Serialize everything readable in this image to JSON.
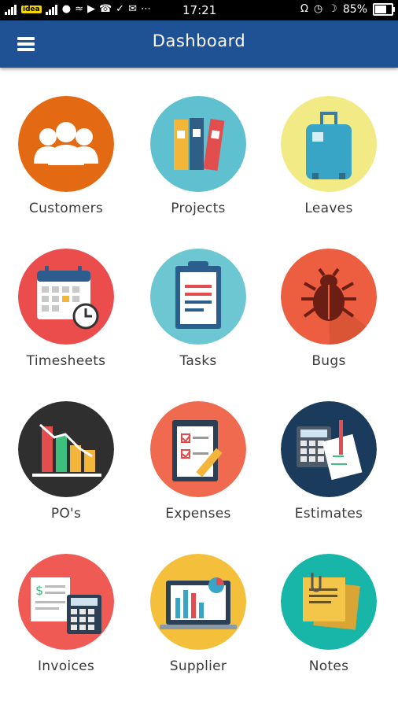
{
  "status_bar": {
    "carrier": "idea",
    "time": "17:21",
    "battery": "85%",
    "battery_level": 0.85
  },
  "app_bar": {
    "title": "Dashboard",
    "menu_icon": "hamburger-menu-icon"
  },
  "colors": {
    "app_bar": "#1f5195",
    "status_bar": "#000000",
    "label_text": "#3a3a3a"
  },
  "tiles": [
    {
      "label": "Customers",
      "icon": "customers-icon",
      "color": "#e36a12"
    },
    {
      "label": "Projects",
      "icon": "projects-icon",
      "color": "#5fc0cf"
    },
    {
      "label": "Leaves",
      "icon": "leaves-icon",
      "color": "#f1ea85"
    },
    {
      "label": "Timesheets",
      "icon": "timesheets-icon",
      "color": "#eb4d4d"
    },
    {
      "label": "Tasks",
      "icon": "tasks-icon",
      "color": "#6cc7d2"
    },
    {
      "label": "Bugs",
      "icon": "bugs-icon",
      "color": "#ec5e3f"
    },
    {
      "label": "PO's",
      "icon": "pos-icon",
      "color": "#2f2f2f"
    },
    {
      "label": "Expenses",
      "icon": "expenses-icon",
      "color": "#ef6a4f"
    },
    {
      "label": "Estimates",
      "icon": "estimates-icon",
      "color": "#1a3b5c"
    },
    {
      "label": "Invoices",
      "icon": "invoices-icon",
      "color": "#ef5b54"
    },
    {
      "label": "Supplier",
      "icon": "supplier-icon",
      "color": "#f4bf3a"
    },
    {
      "label": "Notes",
      "icon": "notes-icon",
      "color": "#18b6a8"
    }
  ]
}
